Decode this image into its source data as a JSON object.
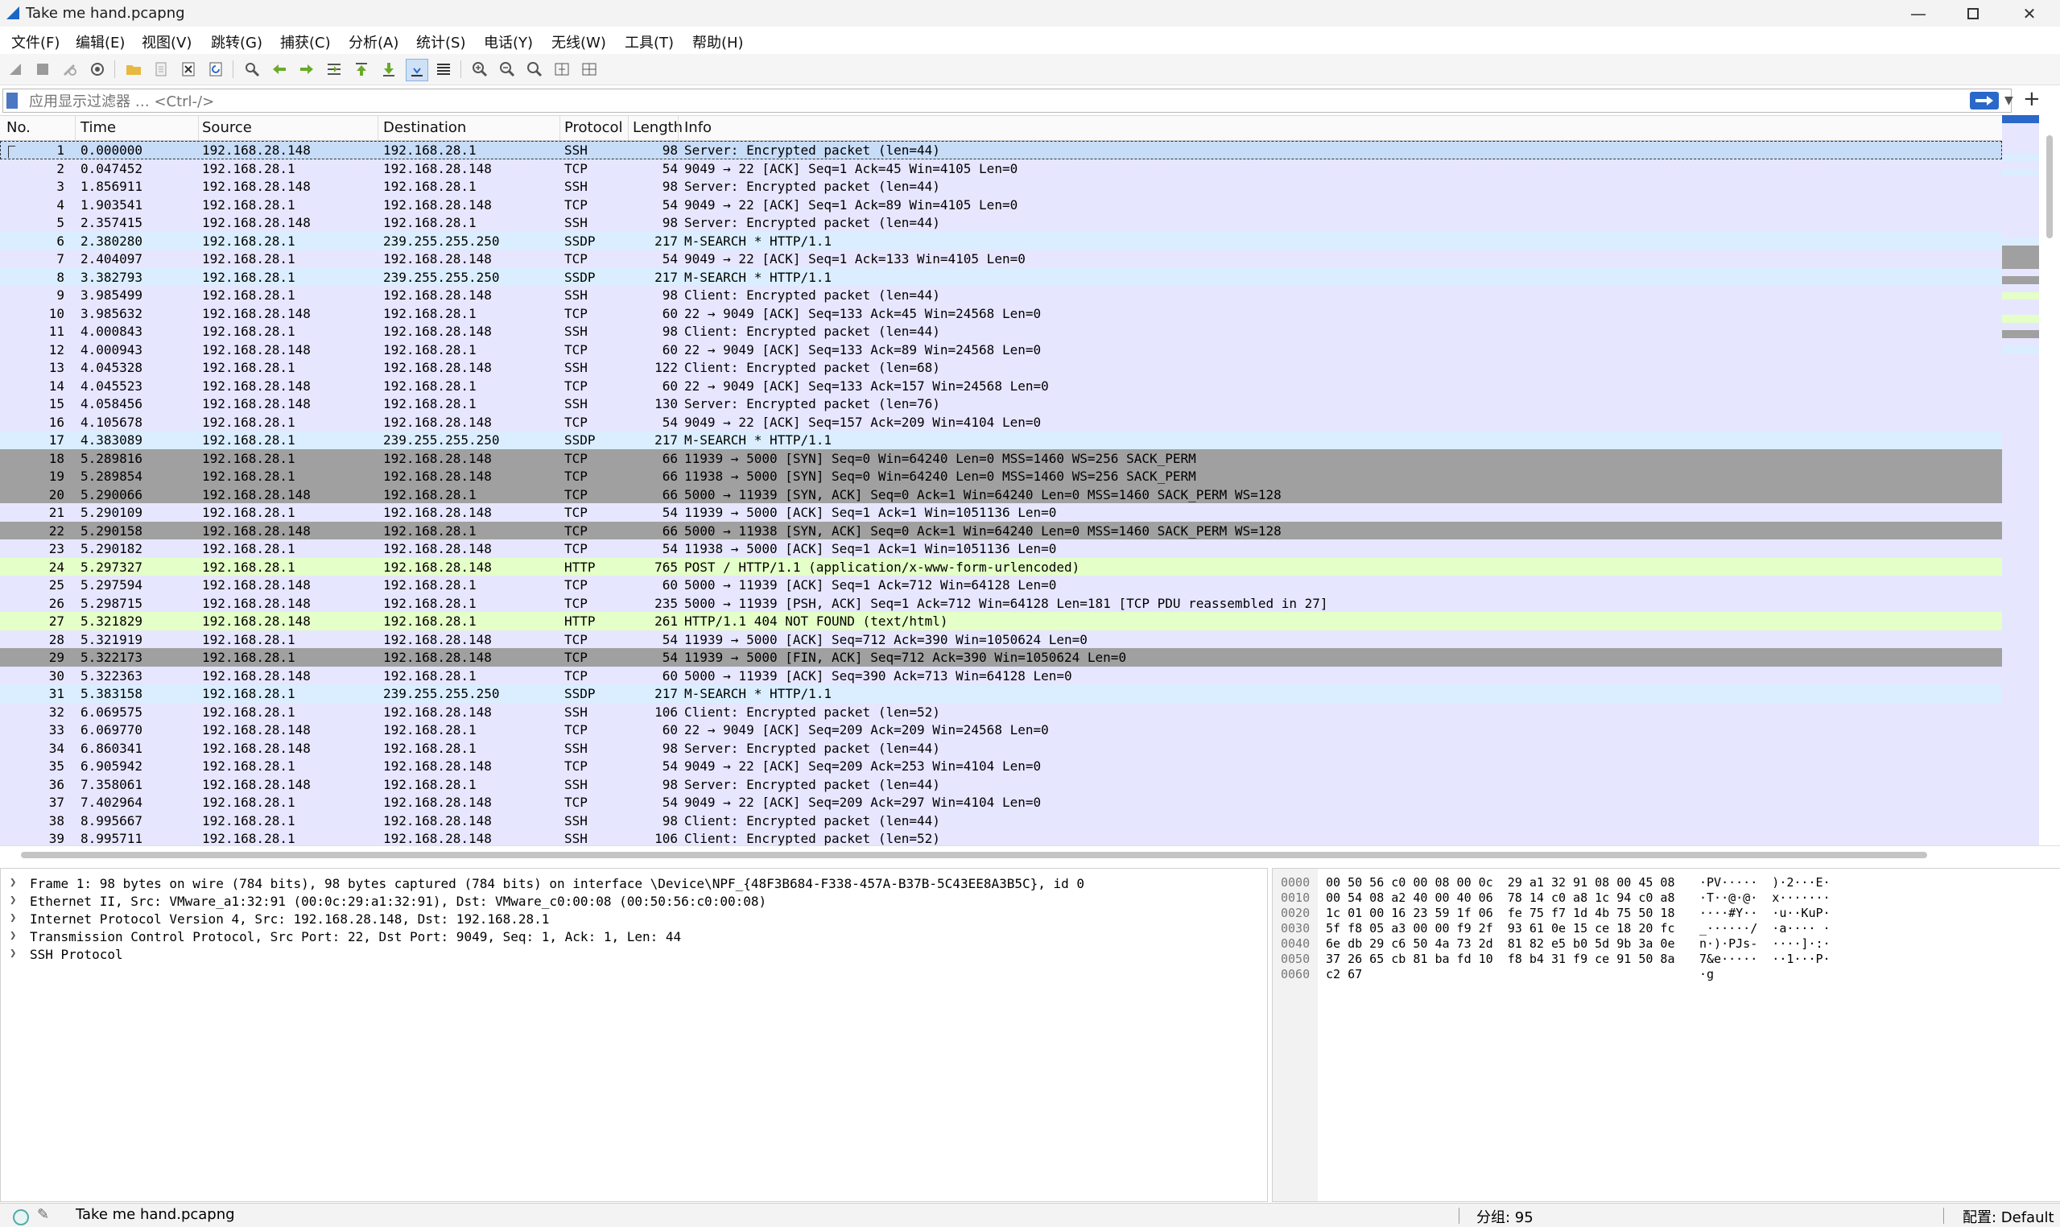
{
  "window": {
    "title": "Take me hand.pcapng",
    "minimize_icon": "minimize-icon",
    "maximize_icon": "maximize-icon",
    "close_icon": "close-icon"
  },
  "menu": [
    {
      "label": "文件(F)"
    },
    {
      "label": "编辑(E)"
    },
    {
      "label": "视图(V)"
    },
    {
      "label": "跳转(G)"
    },
    {
      "label": "捕获(C)"
    },
    {
      "label": "分析(A)"
    },
    {
      "label": "统计(S)"
    },
    {
      "label": "电话(Y)"
    },
    {
      "label": "无线(W)"
    },
    {
      "label": "工具(T)"
    },
    {
      "label": "帮助(H)"
    }
  ],
  "toolbar": {
    "icons": [
      "start-capture-icon",
      "stop-capture-icon",
      "restart-capture-icon",
      "capture-options-icon",
      "open-file-icon",
      "save-file-icon",
      "close-file-icon",
      "reload-icon",
      "find-packet-icon",
      "go-back-icon",
      "go-forward-icon",
      "go-to-packet-icon",
      "go-first-icon",
      "go-last-icon",
      "autoscroll-icon",
      "colorize-icon",
      "zoom-in-icon",
      "zoom-out-icon",
      "normal-size-icon",
      "resize-columns-icon",
      "layout-icon"
    ]
  },
  "filter": {
    "placeholder": "应用显示过滤器 … <Ctrl-/>",
    "value": ""
  },
  "packet_list": {
    "columns": [
      "No.",
      "Time",
      "Source",
      "Destination",
      "Protocol",
      "Length",
      "Info"
    ],
    "colors": {
      "ssh": "#e7e6ff",
      "tcp": "#e7e6ff",
      "ssdp": "#daeeff",
      "http": "#e4ffc7",
      "syn_fin": "#a0a0a0",
      "selected": "#c7dcf7"
    },
    "rows": [
      {
        "no": "1",
        "time": "0.000000",
        "src": "192.168.28.148",
        "dst": "192.168.28.1",
        "proto": "SSH",
        "len": "98",
        "info": "Server: Encrypted packet (len=44)",
        "cls": "ssh",
        "selected": true
      },
      {
        "no": "2",
        "time": "0.047452",
        "src": "192.168.28.1",
        "dst": "192.168.28.148",
        "proto": "TCP",
        "len": "54",
        "info": "9049 → 22 [ACK] Seq=1 Ack=45 Win=4105 Len=0",
        "cls": "tcp"
      },
      {
        "no": "3",
        "time": "1.856911",
        "src": "192.168.28.148",
        "dst": "192.168.28.1",
        "proto": "SSH",
        "len": "98",
        "info": "Server: Encrypted packet (len=44)",
        "cls": "ssh"
      },
      {
        "no": "4",
        "time": "1.903541",
        "src": "192.168.28.1",
        "dst": "192.168.28.148",
        "proto": "TCP",
        "len": "54",
        "info": "9049 → 22 [ACK] Seq=1 Ack=89 Win=4105 Len=0",
        "cls": "tcp"
      },
      {
        "no": "5",
        "time": "2.357415",
        "src": "192.168.28.148",
        "dst": "192.168.28.1",
        "proto": "SSH",
        "len": "98",
        "info": "Server: Encrypted packet (len=44)",
        "cls": "ssh"
      },
      {
        "no": "6",
        "time": "2.380280",
        "src": "192.168.28.1",
        "dst": "239.255.255.250",
        "proto": "SSDP",
        "len": "217",
        "info": "M-SEARCH * HTTP/1.1",
        "cls": "ssdp"
      },
      {
        "no": "7",
        "time": "2.404097",
        "src": "192.168.28.1",
        "dst": "192.168.28.148",
        "proto": "TCP",
        "len": "54",
        "info": "9049 → 22 [ACK] Seq=1 Ack=133 Win=4105 Len=0",
        "cls": "tcp"
      },
      {
        "no": "8",
        "time": "3.382793",
        "src": "192.168.28.1",
        "dst": "239.255.255.250",
        "proto": "SSDP",
        "len": "217",
        "info": "M-SEARCH * HTTP/1.1",
        "cls": "ssdp"
      },
      {
        "no": "9",
        "time": "3.985499",
        "src": "192.168.28.1",
        "dst": "192.168.28.148",
        "proto": "SSH",
        "len": "98",
        "info": "Client: Encrypted packet (len=44)",
        "cls": "ssh"
      },
      {
        "no": "10",
        "time": "3.985632",
        "src": "192.168.28.148",
        "dst": "192.168.28.1",
        "proto": "TCP",
        "len": "60",
        "info": "22 → 9049 [ACK] Seq=133 Ack=45 Win=24568 Len=0",
        "cls": "tcp"
      },
      {
        "no": "11",
        "time": "4.000843",
        "src": "192.168.28.1",
        "dst": "192.168.28.148",
        "proto": "SSH",
        "len": "98",
        "info": "Client: Encrypted packet (len=44)",
        "cls": "ssh"
      },
      {
        "no": "12",
        "time": "4.000943",
        "src": "192.168.28.148",
        "dst": "192.168.28.1",
        "proto": "TCP",
        "len": "60",
        "info": "22 → 9049 [ACK] Seq=133 Ack=89 Win=24568 Len=0",
        "cls": "tcp"
      },
      {
        "no": "13",
        "time": "4.045328",
        "src": "192.168.28.1",
        "dst": "192.168.28.148",
        "proto": "SSH",
        "len": "122",
        "info": "Client: Encrypted packet (len=68)",
        "cls": "ssh"
      },
      {
        "no": "14",
        "time": "4.045523",
        "src": "192.168.28.148",
        "dst": "192.168.28.1",
        "proto": "TCP",
        "len": "60",
        "info": "22 → 9049 [ACK] Seq=133 Ack=157 Win=24568 Len=0",
        "cls": "tcp"
      },
      {
        "no": "15",
        "time": "4.058456",
        "src": "192.168.28.148",
        "dst": "192.168.28.1",
        "proto": "SSH",
        "len": "130",
        "info": "Server: Encrypted packet (len=76)",
        "cls": "ssh"
      },
      {
        "no": "16",
        "time": "4.105678",
        "src": "192.168.28.1",
        "dst": "192.168.28.148",
        "proto": "TCP",
        "len": "54",
        "info": "9049 → 22 [ACK] Seq=157 Ack=209 Win=4104 Len=0",
        "cls": "tcp"
      },
      {
        "no": "17",
        "time": "4.383089",
        "src": "192.168.28.1",
        "dst": "239.255.255.250",
        "proto": "SSDP",
        "len": "217",
        "info": "M-SEARCH * HTTP/1.1",
        "cls": "ssdp"
      },
      {
        "no": "18",
        "time": "5.289816",
        "src": "192.168.28.1",
        "dst": "192.168.28.148",
        "proto": "TCP",
        "len": "66",
        "info": "11939 → 5000 [SYN] Seq=0 Win=64240 Len=0 MSS=1460 WS=256 SACK_PERM",
        "cls": "syn_fin"
      },
      {
        "no": "19",
        "time": "5.289854",
        "src": "192.168.28.1",
        "dst": "192.168.28.148",
        "proto": "TCP",
        "len": "66",
        "info": "11938 → 5000 [SYN] Seq=0 Win=64240 Len=0 MSS=1460 WS=256 SACK_PERM",
        "cls": "syn_fin"
      },
      {
        "no": "20",
        "time": "5.290066",
        "src": "192.168.28.148",
        "dst": "192.168.28.1",
        "proto": "TCP",
        "len": "66",
        "info": "5000 → 11939 [SYN, ACK] Seq=0 Ack=1 Win=64240 Len=0 MSS=1460 SACK_PERM WS=128",
        "cls": "syn_fin"
      },
      {
        "no": "21",
        "time": "5.290109",
        "src": "192.168.28.1",
        "dst": "192.168.28.148",
        "proto": "TCP",
        "len": "54",
        "info": "11939 → 5000 [ACK] Seq=1 Ack=1 Win=1051136 Len=0",
        "cls": "tcp"
      },
      {
        "no": "22",
        "time": "5.290158",
        "src": "192.168.28.148",
        "dst": "192.168.28.1",
        "proto": "TCP",
        "len": "66",
        "info": "5000 → 11938 [SYN, ACK] Seq=0 Ack=1 Win=64240 Len=0 MSS=1460 SACK_PERM WS=128",
        "cls": "syn_fin"
      },
      {
        "no": "23",
        "time": "5.290182",
        "src": "192.168.28.1",
        "dst": "192.168.28.148",
        "proto": "TCP",
        "len": "54",
        "info": "11938 → 5000 [ACK] Seq=1 Ack=1 Win=1051136 Len=0",
        "cls": "tcp"
      },
      {
        "no": "24",
        "time": "5.297327",
        "src": "192.168.28.1",
        "dst": "192.168.28.148",
        "proto": "HTTP",
        "len": "765",
        "info": "POST / HTTP/1.1  (application/x-www-form-urlencoded)",
        "cls": "http"
      },
      {
        "no": "25",
        "time": "5.297594",
        "src": "192.168.28.148",
        "dst": "192.168.28.1",
        "proto": "TCP",
        "len": "60",
        "info": "5000 → 11939 [ACK] Seq=1 Ack=712 Win=64128 Len=0",
        "cls": "tcp"
      },
      {
        "no": "26",
        "time": "5.298715",
        "src": "192.168.28.148",
        "dst": "192.168.28.1",
        "proto": "TCP",
        "len": "235",
        "info": "5000 → 11939 [PSH, ACK] Seq=1 Ack=712 Win=64128 Len=181 [TCP PDU reassembled in 27]",
        "cls": "tcp"
      },
      {
        "no": "27",
        "time": "5.321829",
        "src": "192.168.28.148",
        "dst": "192.168.28.1",
        "proto": "HTTP",
        "len": "261",
        "info": "HTTP/1.1 404 NOT FOUND  (text/html)",
        "cls": "http"
      },
      {
        "no": "28",
        "time": "5.321919",
        "src": "192.168.28.1",
        "dst": "192.168.28.148",
        "proto": "TCP",
        "len": "54",
        "info": "11939 → 5000 [ACK] Seq=712 Ack=390 Win=1050624 Len=0",
        "cls": "tcp"
      },
      {
        "no": "29",
        "time": "5.322173",
        "src": "192.168.28.1",
        "dst": "192.168.28.148",
        "proto": "TCP",
        "len": "54",
        "info": "11939 → 5000 [FIN, ACK] Seq=712 Ack=390 Win=1050624 Len=0",
        "cls": "syn_fin"
      },
      {
        "no": "30",
        "time": "5.322363",
        "src": "192.168.28.148",
        "dst": "192.168.28.1",
        "proto": "TCP",
        "len": "60",
        "info": "5000 → 11939 [ACK] Seq=390 Ack=713 Win=64128 Len=0",
        "cls": "tcp"
      },
      {
        "no": "31",
        "time": "5.383158",
        "src": "192.168.28.1",
        "dst": "239.255.255.250",
        "proto": "SSDP",
        "len": "217",
        "info": "M-SEARCH * HTTP/1.1",
        "cls": "ssdp"
      },
      {
        "no": "32",
        "time": "6.069575",
        "src": "192.168.28.1",
        "dst": "192.168.28.148",
        "proto": "SSH",
        "len": "106",
        "info": "Client: Encrypted packet (len=52)",
        "cls": "ssh"
      },
      {
        "no": "33",
        "time": "6.069770",
        "src": "192.168.28.148",
        "dst": "192.168.28.1",
        "proto": "TCP",
        "len": "60",
        "info": "22 → 9049 [ACK] Seq=209 Ack=209 Win=24568 Len=0",
        "cls": "tcp"
      },
      {
        "no": "34",
        "time": "6.860341",
        "src": "192.168.28.148",
        "dst": "192.168.28.1",
        "proto": "SSH",
        "len": "98",
        "info": "Server: Encrypted packet (len=44)",
        "cls": "ssh"
      },
      {
        "no": "35",
        "time": "6.905942",
        "src": "192.168.28.1",
        "dst": "192.168.28.148",
        "proto": "TCP",
        "len": "54",
        "info": "9049 → 22 [ACK] Seq=209 Ack=253 Win=4104 Len=0",
        "cls": "tcp"
      },
      {
        "no": "36",
        "time": "7.358061",
        "src": "192.168.28.148",
        "dst": "192.168.28.1",
        "proto": "SSH",
        "len": "98",
        "info": "Server: Encrypted packet (len=44)",
        "cls": "ssh"
      },
      {
        "no": "37",
        "time": "7.402964",
        "src": "192.168.28.1",
        "dst": "192.168.28.148",
        "proto": "TCP",
        "len": "54",
        "info": "9049 → 22 [ACK] Seq=209 Ack=297 Win=4104 Len=0",
        "cls": "tcp"
      },
      {
        "no": "38",
        "time": "8.995667",
        "src": "192.168.28.1",
        "dst": "192.168.28.148",
        "proto": "SSH",
        "len": "98",
        "info": "Client: Encrypted packet (len=44)",
        "cls": "ssh"
      },
      {
        "no": "39",
        "time": "8.995711",
        "src": "192.168.28.1",
        "dst": "192.168.28.148",
        "proto": "SSH",
        "len": "106",
        "info": "Client: Encrypted packet (len=52)",
        "cls": "ssh"
      }
    ]
  },
  "details": [
    {
      "label": "Frame 1: 98 bytes on wire (784 bits), 98 bytes captured (784 bits) on interface \\Device\\NPF_{48F3B684-F338-457A-B37B-5C43EE8A3B5C}, id 0"
    },
    {
      "label": "Ethernet II, Src: VMware_a1:32:91 (00:0c:29:a1:32:91), Dst: VMware_c0:00:08 (00:50:56:c0:00:08)"
    },
    {
      "label": "Internet Protocol Version 4, Src: 192.168.28.148, Dst: 192.168.28.1"
    },
    {
      "label": "Transmission Control Protocol, Src Port: 22, Dst Port: 9049, Seq: 1, Ack: 1, Len: 44"
    },
    {
      "label": "SSH Protocol"
    }
  ],
  "bytes": [
    {
      "offset": "0000",
      "hex": "00 50 56 c0 00 08 00 0c  29 a1 32 91 08 00 45 08",
      "ascii": "·PV·····  )·2···E·"
    },
    {
      "offset": "0010",
      "hex": "00 54 08 a2 40 00 40 06  78 14 c0 a8 1c 94 c0 a8",
      "ascii": "·T··@·@·  x·······"
    },
    {
      "offset": "0020",
      "hex": "1c 01 00 16 23 59 1f 06  fe 75 f7 1d 4b 75 50 18",
      "ascii": "····#Y··  ·u··KuP·"
    },
    {
      "offset": "0030",
      "hex": "5f f8 05 a3 00 00 f9 2f  93 61 0e 15 ce 18 20 fc",
      "ascii": "_······/  ·a···· ·"
    },
    {
      "offset": "0040",
      "hex": "6e db 29 c6 50 4a 73 2d  81 82 e5 b0 5d 9b 3a 0e",
      "ascii": "n·)·PJs-  ····]·:·"
    },
    {
      "offset": "0050",
      "hex": "37 26 65 cb 81 ba fd 10  f8 b4 31 f9 ce 91 50 8a",
      "ascii": "7&e·····  ··1···P·"
    },
    {
      "offset": "0060",
      "hex": "c2 67",
      "ascii": "·g"
    }
  ],
  "status": {
    "file": "Take me hand.pcapng",
    "packets": "分组: 95",
    "profile": "配置: Default"
  }
}
